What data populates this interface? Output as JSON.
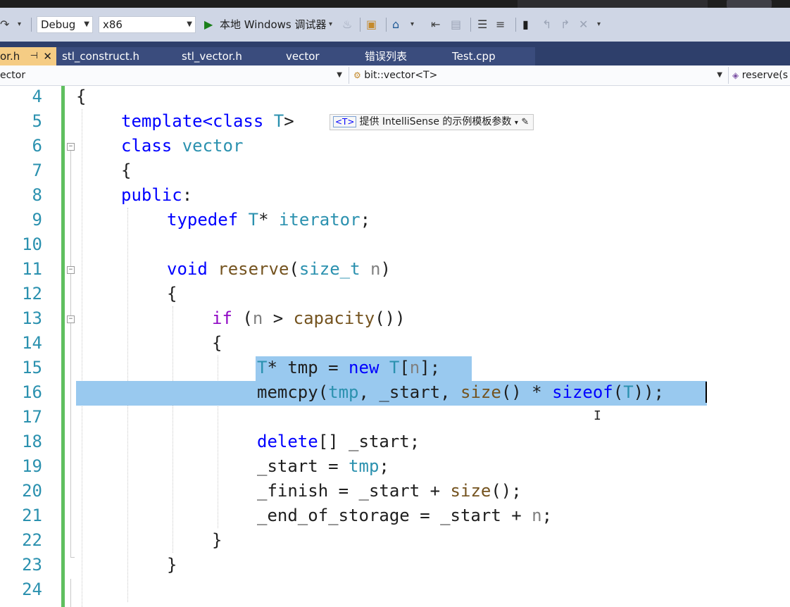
{
  "toolbar": {
    "config": "Debug",
    "platform": "x86",
    "debugger_label": "本地 Windows 调试器"
  },
  "tabs": [
    {
      "label": "or.h",
      "active": true
    },
    {
      "label": "stl_construct.h"
    },
    {
      "label": "stl_vector.h"
    },
    {
      "label": "vector"
    },
    {
      "label": "错误列表"
    },
    {
      "label": "Test.cpp"
    }
  ],
  "navbar": {
    "project": "ector",
    "scope": "bit::vector<T>",
    "member": "reserve(s"
  },
  "hint": {
    "param": "<T>",
    "text": "提供 IntelliSense 的示例模板参数"
  },
  "line_numbers": [
    "4",
    "5",
    "6",
    "7",
    "8",
    "9",
    "10",
    "11",
    "12",
    "13",
    "14",
    "15",
    "16",
    "17",
    "18",
    "19",
    "20",
    "21",
    "22",
    "23",
    "24"
  ],
  "code": {
    "l4": "{",
    "l5_kw": "template",
    "l5_rest": "<class ",
    "l5_T": "T",
    "l5_end": ">",
    "l6_kw": "class",
    "l6_name": "vector",
    "l7": "{",
    "l8_kw": "public",
    "l8_end": ":",
    "l9_kw": "typedef",
    "l9_T": "T",
    "l9_rest": "* ",
    "l9_it": "iterator",
    "l9_end": ";",
    "l11_kw": "void",
    "l11_fn": "reserve",
    "l11_open": "(",
    "l11_ty": "size_t",
    "l11_n": "n",
    "l11_close": ")",
    "l12": "{",
    "l13_kw": "if",
    "l13_open": " (",
    "l13_n": "n",
    "l13_gt": " > ",
    "l13_fn": "capacity",
    "l13_end": "())",
    "l14": "{",
    "l15_T": "T",
    "l15_a": "* tmp = ",
    "l15_new": "new",
    "l15_T2": "T",
    "l15_b": "[",
    "l15_n": "n",
    "l15_c": "];",
    "l16_a": "memcpy(",
    "l16_tmp": "tmp",
    "l16_b": ", _start, ",
    "l16_size": "size",
    "l16_c": "() * ",
    "l16_sizeof": "sizeof",
    "l16_d": "(",
    "l16_T": "T",
    "l16_e": "));",
    "l18_kw": "delete",
    "l18_rest": "[] _start;",
    "l19_a": "_start = ",
    "l19_tmp": "tmp",
    "l19_end": ";",
    "l20_a": "_finish = _start + ",
    "l20_fn": "size",
    "l20_end": "();",
    "l21_a": "_end_of_storage = _start + ",
    "l21_n": "n",
    "l21_end": ";",
    "l22": "}",
    "l23": "}"
  },
  "colors": {
    "keyword": "#0000ff",
    "type": "#2b91af",
    "function": "#74531f",
    "parameter": "#808080",
    "selection": "#99c9ef",
    "change_bar": "#5fbf5f",
    "tab_bar": "#2e3f6b",
    "active_tab": "#f5cc84"
  }
}
